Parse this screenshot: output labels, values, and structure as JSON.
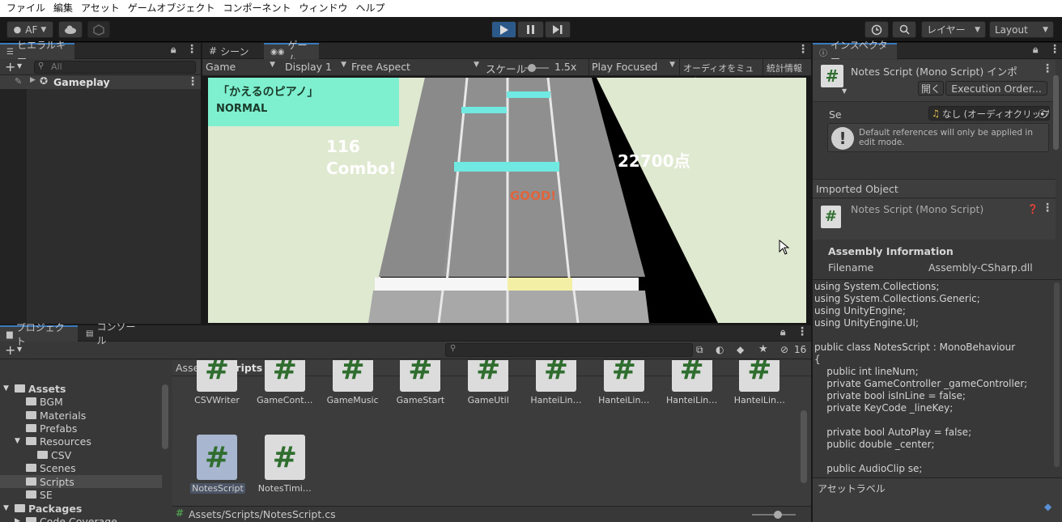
{
  "menu": [
    "ファイル",
    "編集",
    "アセット",
    "ゲームオブジェクト",
    "コンポーネント",
    "ウィンドウ",
    "ヘルプ"
  ],
  "toolbar": {
    "account": "AF",
    "layers": "レイヤー",
    "layout": "Layout"
  },
  "hierarchy": {
    "tab": "ヒエラルキー",
    "search_placeholder": "All",
    "root": "Gameplay"
  },
  "scene_tabs": {
    "scene": "シーン",
    "game": "ゲーム"
  },
  "game_toolbar": {
    "view": "Game",
    "display": "Display 1",
    "aspect": "Free Aspect",
    "scale_label": "スケール",
    "scale_value": "1.5x",
    "play_mode": "Play Focused",
    "mute": "オーディオをミュート",
    "stats": "統計情報"
  },
  "game_view": {
    "song_title": "「かえるのピアノ」",
    "difficulty": "NORMAL",
    "combo_count": "116",
    "combo_label": "Combo!",
    "score": "22700点",
    "judge": "GOOD!"
  },
  "project": {
    "tab": "プロジェクト",
    "console_tab": "コンソール",
    "hidden_count": "16",
    "breadcrumb_root": "Assets",
    "breadcrumb_current": "Scripts",
    "path": "Assets/Scripts/NotesScript.cs",
    "tree": [
      {
        "label": "Assets",
        "bold": true
      },
      {
        "label": "BGM"
      },
      {
        "label": "Materials"
      },
      {
        "label": "Prefabs"
      },
      {
        "label": "Resources"
      },
      {
        "label": "CSV"
      },
      {
        "label": "Scenes"
      },
      {
        "label": "Scripts"
      },
      {
        "label": "SE"
      },
      {
        "label": "Packages",
        "bold": true
      },
      {
        "label": "Code Coverage"
      }
    ],
    "assets_row1": [
      "CSVWriter",
      "GameCont…",
      "GameMusic",
      "GameStart",
      "GameUtil",
      "HanteiLin…",
      "HanteiLin…",
      "HanteiLin…",
      "HanteiLin…"
    ],
    "assets_row2": [
      "NotesScript",
      "NotesTimi…"
    ]
  },
  "inspector": {
    "tab": "インスペクター",
    "title": "Notes Script (Mono Script) インポ",
    "open_button": "開く",
    "exec_order_button": "Execution Order...",
    "se_label": "Se",
    "se_value": "なし (オーディオクリップ)",
    "help_text": "Default references will only be applied in edit mode.",
    "imported_object": "Imported Object",
    "sub_title": "Notes Script (Mono Script)",
    "assembly_header": "Assembly Information",
    "filename_label": "Filename",
    "filename_value": "Assembly-CSharp.dll",
    "code": "using System.Collections;\nusing System.Collections.Generic;\nusing UnityEngine;\nusing UnityEngine.UI;\n\npublic class NotesScript : MonoBehaviour\n{\n    public int lineNum;\n    private GameController _gameController;\n    private bool isInLine = false;\n    private KeyCode _lineKey;\n\n    private bool AutoPlay = false;\n    public double _center;\n\n    public AudioClip se;",
    "asset_labels": "アセットラベル"
  }
}
